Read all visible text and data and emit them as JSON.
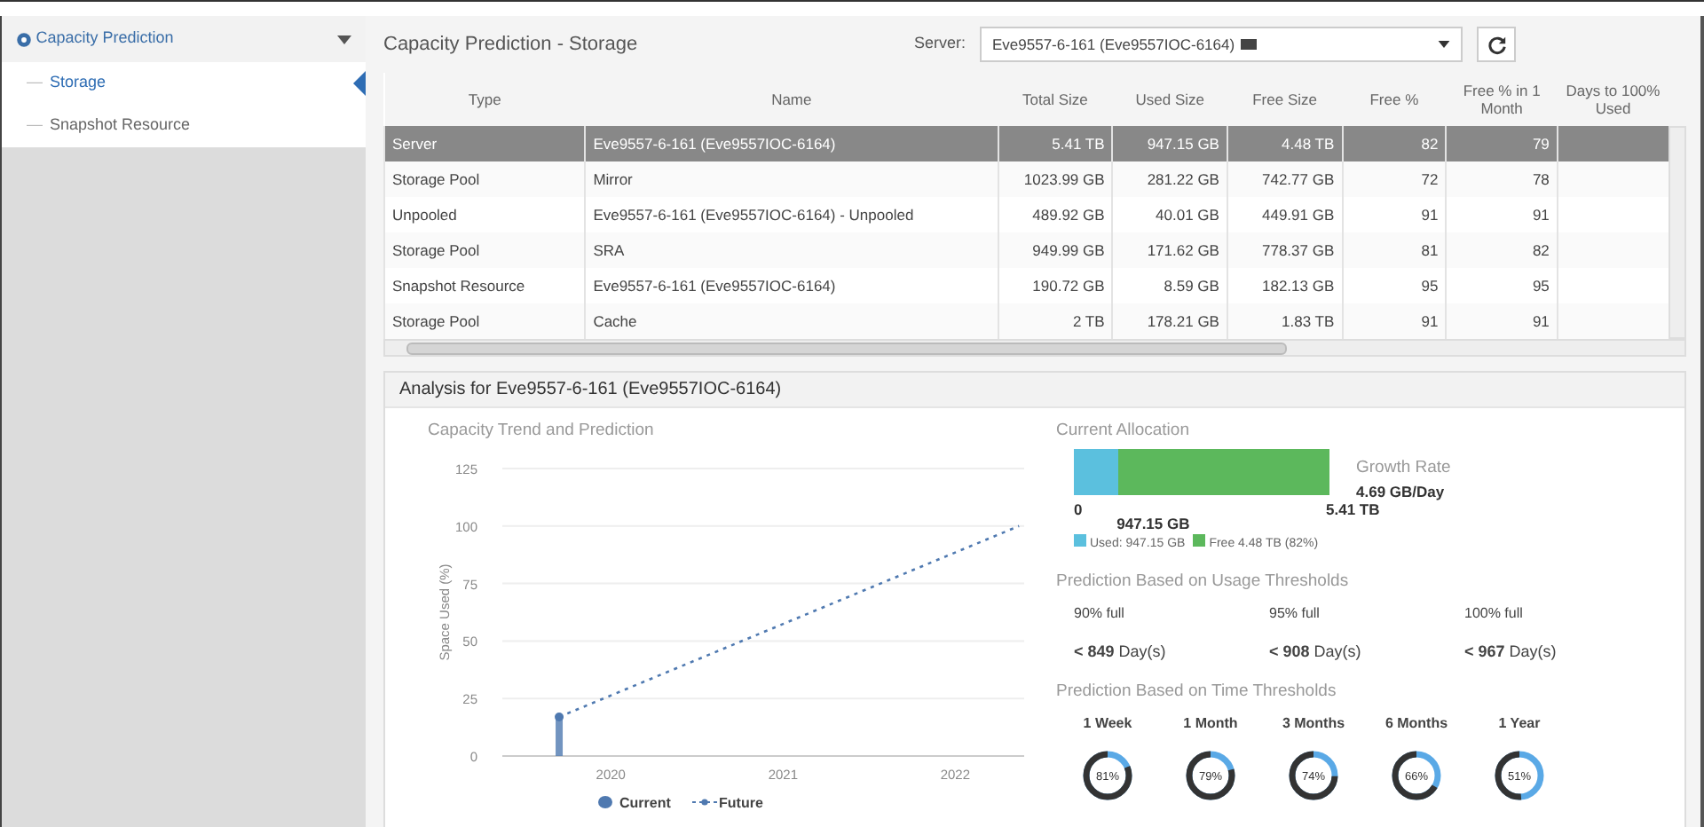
{
  "sidebar": {
    "title": "Capacity Prediction",
    "expanded": true,
    "items": [
      {
        "marker": "—",
        "label": "Storage",
        "selected": true
      },
      {
        "marker": "—",
        "label": "Snapshot Resource",
        "selected": false
      }
    ]
  },
  "header": {
    "title": "Capacity Prediction - Storage",
    "server_label": "Server:",
    "server_value": "Eve9557-6-161 (Eve9557IOC-6164)"
  },
  "table": {
    "columns": [
      "Type",
      "Name",
      "Total Size",
      "Used Size",
      "Free Size",
      "Free %",
      "Free % in 1 Month",
      "Days to 100% Used"
    ],
    "rows": [
      {
        "selected": true,
        "cells": [
          "Server",
          "Eve9557-6-161 (Eve9557IOC-6164)",
          "5.41 TB",
          "947.15 GB",
          "4.48 TB",
          "82",
          "79",
          ""
        ]
      },
      {
        "selected": false,
        "cells": [
          "Storage Pool",
          "Mirror",
          "1023.99 GB",
          "281.22 GB",
          "742.77 GB",
          "72",
          "78",
          ""
        ]
      },
      {
        "selected": false,
        "cells": [
          "Unpooled",
          "Eve9557-6-161 (Eve9557IOC-6164) - Unpooled",
          "489.92 GB",
          "40.01 GB",
          "449.91 GB",
          "91",
          "91",
          ""
        ]
      },
      {
        "selected": false,
        "cells": [
          "Storage Pool",
          "SRA",
          "949.99 GB",
          "171.62 GB",
          "778.37 GB",
          "81",
          "82",
          ""
        ]
      },
      {
        "selected": false,
        "cells": [
          "Snapshot Resource",
          "Eve9557-6-161 (Eve9557IOC-6164)",
          "190.72 GB",
          "8.59 GB",
          "182.13 GB",
          "95",
          "95",
          ""
        ]
      },
      {
        "selected": false,
        "cells": [
          "Storage Pool",
          "Cache",
          "2 TB",
          "178.21 GB",
          "1.83 TB",
          "91",
          "91",
          ""
        ]
      }
    ]
  },
  "analysis": {
    "title": "Analysis for Eve9557-6-161 (Eve9557IOC-6164)",
    "trend": {
      "title": "Capacity Trend and Prediction",
      "chart_data": {
        "type": "line",
        "grid": true,
        "legend": "bottom",
        "ylabel": "Space Used (%)",
        "x": [
          2019.7,
          2022.37
        ],
        "xlim": [
          2019.37,
          2022.4
        ],
        "ylim": [
          0,
          125
        ],
        "xticks": [
          2020,
          2021,
          2022
        ],
        "yticks": [
          0,
          25,
          50,
          75,
          100,
          125
        ],
        "series": [
          {
            "name": "Current",
            "color": "#4f79b0",
            "type": "bar",
            "marker": "circle",
            "values": [
              17,
              null
            ]
          },
          {
            "name": "Future",
            "color": "#4f79b0",
            "line_style": "dashed",
            "values": [
              17,
              100
            ]
          }
        ]
      }
    },
    "allocation": {
      "title": "Current Allocation",
      "level": 0.175,
      "tick_start": "0",
      "tick_used": "947.15 GB",
      "tick_total": "5.41 TB",
      "legend": [
        {
          "label": "Used: 947.15 GB",
          "color": "#5bc0de"
        },
        {
          "label": "Free 4.48 TB (82%)",
          "color": "#5cb85c"
        }
      ],
      "growth_label": "Growth Rate",
      "growth_value": "4.69 GB/Day"
    },
    "usage": {
      "title": "Prediction Based on Usage Thresholds",
      "items": [
        {
          "label": "90% full",
          "value": "**< 849** Day(s)"
        },
        {
          "label": "95% full",
          "value": "**< 908** Day(s)"
        },
        {
          "label": "100% full",
          "value": "**< 967** Day(s)"
        }
      ]
    },
    "time": {
      "title": "Prediction Based on Time Thresholds",
      "items": [
        {
          "label": "1 Week",
          "value": "81%",
          "level": 0.81
        },
        {
          "label": "1 Month",
          "value": "79%",
          "level": 0.79
        },
        {
          "label": "3 Months",
          "value": "74%",
          "level": 0.74
        },
        {
          "label": "6 Months",
          "value": "66%",
          "level": 0.66
        },
        {
          "label": "1 Year",
          "value": "51%",
          "level": 0.51
        }
      ]
    }
  }
}
